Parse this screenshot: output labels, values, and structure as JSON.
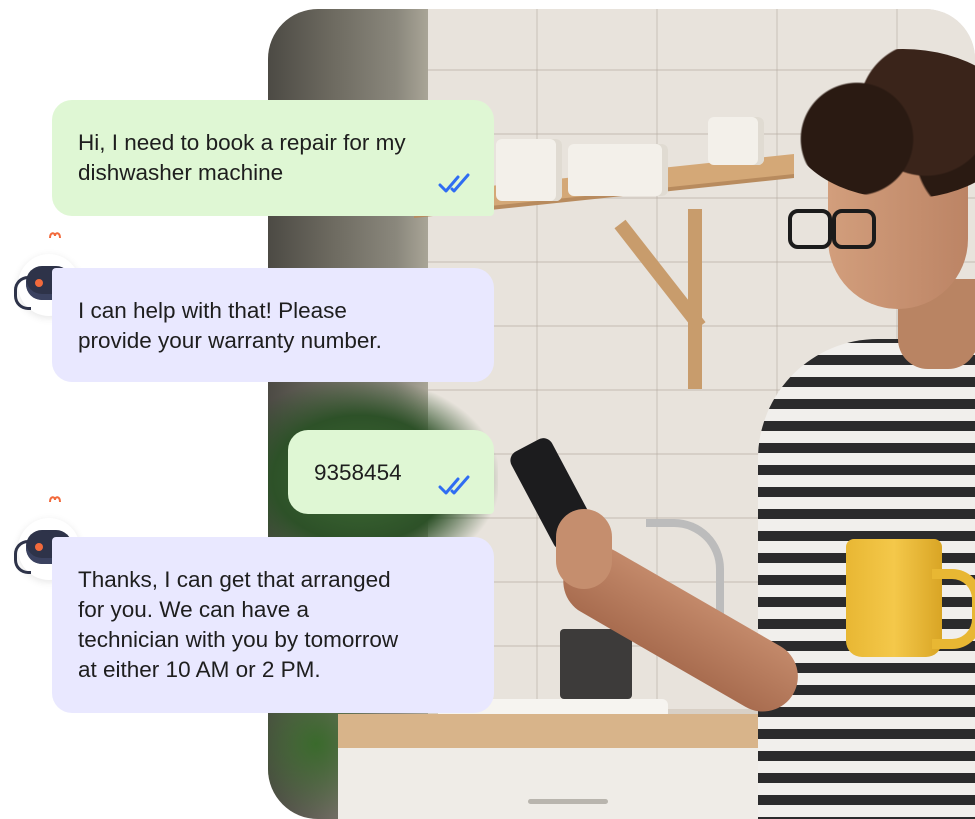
{
  "chat": {
    "messages": [
      {
        "sender": "user",
        "text": "Hi, I need to book a repair for my\ndishwasher machine",
        "status": "read"
      },
      {
        "sender": "bot",
        "text": "I can help with that! Please\nprovide your warranty number."
      },
      {
        "sender": "user",
        "text": "9358454",
        "status": "read"
      },
      {
        "sender": "bot",
        "text": "Thanks, I can get that arranged\nfor you. We can have a\ntechnician with you by tomorrow\nat either 10 AM or 2 PM."
      }
    ]
  },
  "icons": {
    "read_receipt": "double-check-icon",
    "bot_avatar": "robot-avatar-icon"
  },
  "colors": {
    "user_bubble": "#dff7d4",
    "bot_bubble": "#e9e8ff",
    "check_blue": "#2f6df2",
    "robot_eye": "#f26a3c"
  }
}
